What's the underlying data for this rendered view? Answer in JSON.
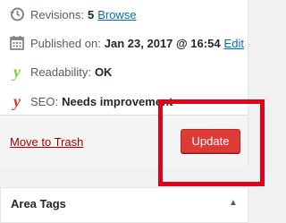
{
  "publish": {
    "revisions": {
      "label": "Revisions:",
      "count": "5",
      "link": "Browse"
    },
    "published": {
      "label": "Published on:",
      "value": "Jan 23, 2017 @ 16:54",
      "link": "Edit"
    },
    "readability": {
      "label": "Readability:",
      "value": "OK",
      "color": "#7ad03a"
    },
    "seo": {
      "label": "SEO:",
      "value": "Needs improvement",
      "color": "#dc3232"
    },
    "trash_label": "Move to Trash",
    "update_label": "Update"
  },
  "tags_panel": {
    "title": "Area Tags"
  },
  "colors": {
    "update_button": "#dd3b35",
    "highlight": "#e3001b",
    "link": "#0073aa"
  }
}
